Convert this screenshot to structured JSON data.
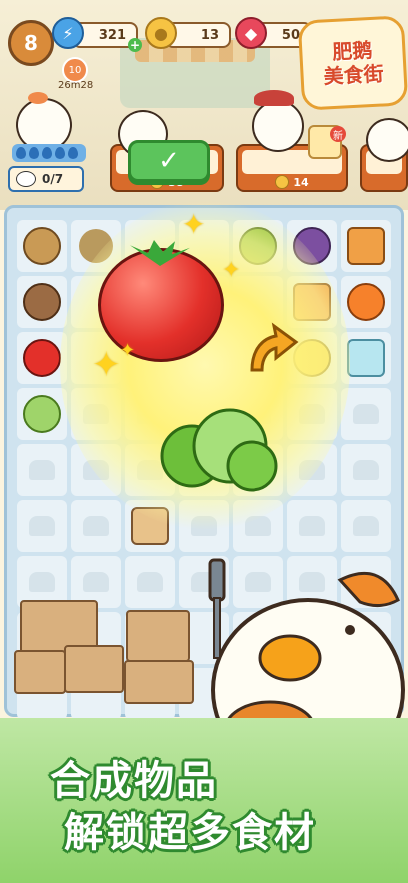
{
  "topbar": {
    "level": "8",
    "energy": "321",
    "coins": "13",
    "gems": "50",
    "timer_count": "10",
    "timer": "26m28"
  },
  "logo": {
    "line1": "肥鹅",
    "line2": "美食街"
  },
  "customers": [
    {
      "progress": "0/7"
    },
    {
      "reward": "38"
    },
    {
      "reward": "14"
    },
    {
      "badge": "新"
    }
  ],
  "board": {
    "rows": 9,
    "cols": 7
  },
  "slogan": {
    "line1": "合成物品",
    "line2": "解锁超多食材"
  },
  "colors": {
    "accent_orange": "#d86b2b",
    "board_blue": "#cfe3ef",
    "banner_green": "#8fd36a",
    "tomato_red": "#e3302a"
  }
}
